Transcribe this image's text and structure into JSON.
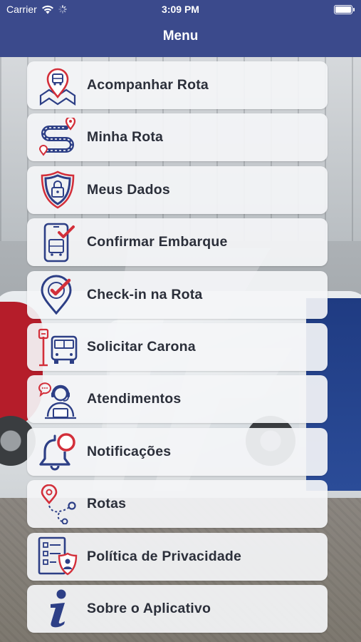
{
  "status_bar": {
    "carrier": "Carrier",
    "time": "3:09 PM"
  },
  "header": {
    "title": "Menu",
    "color": "#3b4a8c"
  },
  "menu": {
    "items": [
      {
        "label": "Acompanhar Rota",
        "icon": "map-bus-pin-icon"
      },
      {
        "label": "Minha Rota",
        "icon": "route-path-icon"
      },
      {
        "label": "Meus Dados",
        "icon": "shield-lock-icon"
      },
      {
        "label": "Confirmar Embarque",
        "icon": "phone-bus-check-icon"
      },
      {
        "label": "Check-in na Rota",
        "icon": "pin-check-icon"
      },
      {
        "label": "Solicitar Carona",
        "icon": "bus-stop-icon"
      },
      {
        "label": "Atendimentos",
        "icon": "support-agent-icon"
      },
      {
        "label": "Notificações",
        "icon": "bell-icon"
      },
      {
        "label": "Rotas",
        "icon": "routes-pin-icon"
      },
      {
        "label": "Política de Privacidade",
        "icon": "privacy-document-icon"
      },
      {
        "label": "Sobre o Aplicativo",
        "icon": "info-icon"
      }
    ]
  },
  "colors": {
    "icon_blue": "#2d3f86",
    "icon_red": "#d32f3a",
    "item_bg": "#f4f5f7",
    "text": "#2b2f3a"
  }
}
